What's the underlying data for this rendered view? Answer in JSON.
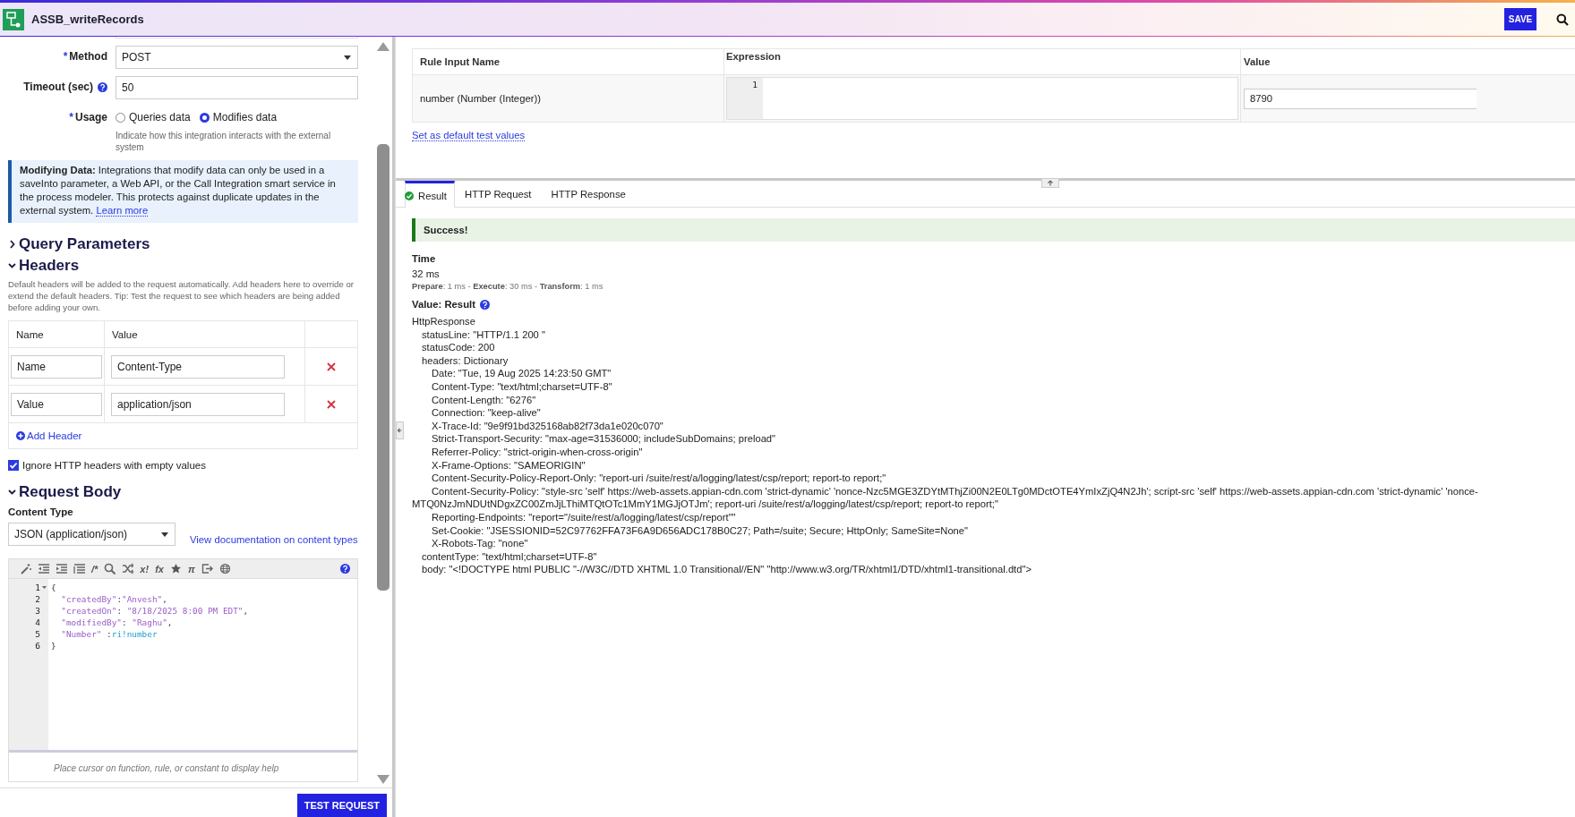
{
  "app": {
    "title": "ASSB_writeRecords",
    "save_label": "SAVE"
  },
  "config": {
    "method": {
      "label": "Method",
      "required_mark": "*",
      "value": "POST"
    },
    "timeout": {
      "label": "Timeout (sec)",
      "value": "50"
    },
    "usage": {
      "label": "Usage",
      "required_mark": "*",
      "options": [
        {
          "label": "Queries data",
          "selected": false
        },
        {
          "label": "Modifies data",
          "selected": true
        }
      ],
      "hint": "Indicate how this integration interacts with the external system"
    },
    "info": {
      "text": "**Modifying Data:** Integrations that modify data can only be used in a saveInto parameter, a Web API, or the Call Integration smart service in the process modeler. This protects against duplicate updates in the external system.",
      "link": "Learn more"
    }
  },
  "query_parameters": {
    "title": "Query Parameters",
    "expanded": false
  },
  "headers": {
    "title": "Headers",
    "expanded": true,
    "description": "Default headers will be added to the request automatically. Add headers here to override or extend the default headers. Tip: Test the request to see which headers are being added before adding your own.",
    "columns": [
      "Name",
      "Value"
    ],
    "rows": [
      {
        "name": "Name",
        "value": "Content-Type"
      },
      {
        "name": "Value",
        "value": "application/json"
      }
    ],
    "add_label": "Add Header",
    "ignore_empty": {
      "label": "Ignore HTTP headers with empty values",
      "checked": true
    }
  },
  "request_body": {
    "title": "Request Body",
    "expanded": true,
    "content_type_label": "Content Type",
    "content_type": "JSON (application/json)",
    "doc_link": "View documentation on content types",
    "toolbar": [
      {
        "kind": "icon"
      },
      {
        "kind": "icon"
      },
      {
        "kind": "icon"
      },
      {
        "kind": "icon"
      },
      {
        "kind": "glyph",
        "text": "/*"
      },
      {
        "kind": "icon"
      },
      {
        "kind": "icon"
      },
      {
        "kind": "glyph",
        "text": "x!"
      },
      {
        "kind": "glyph",
        "text": "fx"
      },
      {
        "kind": "icon"
      },
      {
        "kind": "glyph",
        "text": "π"
      },
      {
        "kind": "icon"
      },
      {
        "kind": "icon"
      }
    ],
    "code": [
      {
        "number": "1",
        "foldable": true,
        "tokens": [
          {
            "kind": "punct",
            "text": "{"
          }
        ]
      },
      {
        "number": "2",
        "foldable": false,
        "tokens": [
          {
            "kind": "key",
            "text": "  \"createdBy\""
          },
          {
            "kind": "punct",
            "text": ":"
          },
          {
            "kind": "key",
            "text": "\"Anvesh\""
          },
          {
            "kind": "punct",
            "text": ","
          }
        ]
      },
      {
        "number": "3",
        "foldable": false,
        "tokens": [
          {
            "kind": "key",
            "text": "  \"createdOn\""
          },
          {
            "kind": "punct",
            "text": ": "
          },
          {
            "kind": "key",
            "text": "\"8/18/2025 8:00 PM EDT\""
          },
          {
            "kind": "punct",
            "text": ","
          }
        ]
      },
      {
        "number": "4",
        "foldable": false,
        "tokens": [
          {
            "kind": "key",
            "text": "  \"modifiedBy\""
          },
          {
            "kind": "punct",
            "text": ": "
          },
          {
            "kind": "key",
            "text": "\"Raghu\""
          },
          {
            "kind": "punct",
            "text": ","
          }
        ]
      },
      {
        "number": "5",
        "foldable": false,
        "tokens": [
          {
            "kind": "key",
            "text": "  \"Number\""
          },
          {
            "kind": "punct",
            "text": " :"
          },
          {
            "kind": "ref",
            "text": "ri!number"
          }
        ]
      },
      {
        "number": "6",
        "foldable": false,
        "tokens": [
          {
            "kind": "punct",
            "text": "}"
          }
        ]
      }
    ],
    "help": "Place cursor on function, rule, or constant to display help"
  },
  "test_button": "TEST REQUEST",
  "test_inputs": {
    "columns": [
      "Rule Input Name",
      "Expression",
      "Value"
    ],
    "rows": [
      {
        "name": "number (Number (Integer))",
        "line": "1",
        "value": "8790"
      }
    ],
    "default_link": "Set as default test values"
  },
  "result_tabs": [
    {
      "label": "Result",
      "selected": true,
      "success": true
    },
    {
      "label": "HTTP Request",
      "selected": false,
      "success": false
    },
    {
      "label": "HTTP Response",
      "selected": false,
      "success": false
    }
  ],
  "result": {
    "message": "Success!",
    "time_label": "Time",
    "time": "32 ms",
    "breakdown": "**Prepare**: 1 ms - **Execute**: 30 ms - **Transform**: 1 ms",
    "value_label": "Value: Result",
    "tree": [
      {
        "text": "HttpResponse",
        "children": [
          {
            "text": "statusLine: \"HTTP/1.1 200 \""
          },
          {
            "text": "statusCode: 200"
          },
          {
            "text": "headers: Dictionary",
            "children": [
              {
                "text": "Date: \"Tue, 19 Aug 2025 14:23:50 GMT\""
              },
              {
                "text": "Content-Type: \"text/html;charset=UTF-8\""
              },
              {
                "text": "Content-Length: \"6276\""
              },
              {
                "text": "Connection: \"keep-alive\""
              },
              {
                "text": "X-Trace-Id: \"9e9f91bd325168ab82f73da1e020c070\""
              },
              {
                "text": "Strict-Transport-Security: \"max-age=31536000; includeSubDomains; preload\""
              },
              {
                "text": "Referrer-Policy: \"strict-origin-when-cross-origin\""
              },
              {
                "text": "X-Frame-Options: \"SAMEORIGIN\""
              },
              {
                "text": "Content-Security-Policy-Report-Only: \"report-uri /suite/rest/a/logging/latest/csp/report; report-to report;\""
              },
              {
                "text": "Content-Security-Policy: \"style-src 'self' https://web-assets.appian-cdn.com 'strict-dynamic' 'nonce-Nzc5MGE3ZDYtMThjZi00N2E0LTg0MDctOTE4YmIxZjQ4N2Jh'; script-src 'self' https://web-assets.appian-cdn.com 'strict-dynamic' 'nonce-MTQ0NzJmNDUtNDgxZC00ZmJjLThiMTQtOTc1MmY1MGJjOTJm'; report-uri /suite/rest/a/logging/latest/csp/report; report-to report;\""
              },
              {
                "text": "Reporting-Endpoints: \"report=\"/suite/rest/a/logging/latest/csp/report\"\""
              },
              {
                "text": "Set-Cookie: \"JSESSIONID=52C97762FFA73F6A9D656ADC178B0C27; Path=/suite; Secure; HttpOnly; SameSite=None\""
              },
              {
                "text": "X-Robots-Tag: \"none\""
              }
            ]
          },
          {
            "text": "contentType: \"text/html;charset=UTF-8\""
          },
          {
            "text": "body: \"<!DOCTYPE html PUBLIC \"-//W3C//DTD XHTML 1.0 Transitional//EN\" \"http://www.w3.org/TR/xhtml1/DTD/xhtml1-transitional.dtd\">"
          }
        ]
      }
    ]
  }
}
